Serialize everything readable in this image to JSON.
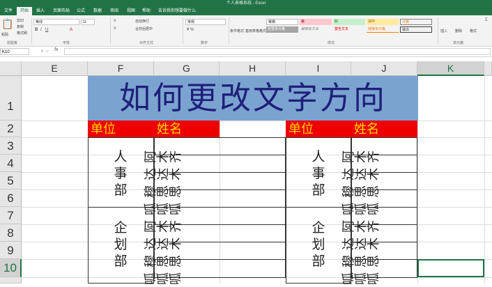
{
  "app": {
    "title": "个人表格系统 - Excel"
  },
  "tabs": [
    "文件",
    "开始",
    "插入",
    "页面布局",
    "公式",
    "数据",
    "审阅",
    "视图",
    "帮助",
    "告诉我你想要做什么"
  ],
  "ribbon": {
    "clipboard": {
      "paste": "粘贴",
      "cut": "剪切",
      "copy": "复制",
      "format_painter": "格式刷",
      "group": "剪贴板"
    },
    "font": {
      "name": "等线",
      "size": "11",
      "group": "字体"
    },
    "alignment": {
      "wrap": "自动换行",
      "merge": "合并后居中",
      "group": "对齐方式"
    },
    "number": {
      "format": "常规",
      "group": "数字"
    },
    "styles": {
      "cond": "条件格式",
      "table": "套用表格格式",
      "group": "样式",
      "cells": [
        "常规",
        "差",
        "好",
        "适中",
        "计算",
        "检查单元格",
        "解释性文本",
        "警告文本",
        "链接单元格",
        "输出"
      ]
    },
    "cells": {
      "insert": "插入",
      "delete": "删除",
      "format": "格式",
      "group": "单元格"
    }
  },
  "formula_bar": {
    "name_box": "K10",
    "fx": "fx",
    "value": ""
  },
  "columns": [
    "E",
    "F",
    "G",
    "H",
    "I",
    "J",
    "K"
  ],
  "rows": [
    "1",
    "2",
    "3",
    "4",
    "5",
    "6",
    "7",
    "8",
    "9",
    "10"
  ],
  "sheet": {
    "title": "如何更改文字方向",
    "header_left": {
      "unit": "单位",
      "name": "姓名"
    },
    "header_right": {
      "unit": "单位",
      "name": "姓名"
    },
    "dept1": [
      "人",
      "事",
      "部"
    ],
    "dept2": [
      "企",
      "划",
      "部"
    ],
    "names": [
      "阿木齐",
      "达达木",
      "穆思思",
      "呱呱呱"
    ]
  },
  "colors": {
    "excel_green": "#217346",
    "title_fill": "#7ba3d0",
    "header_fill": "#ee0000",
    "header_text": "#ffd800"
  }
}
